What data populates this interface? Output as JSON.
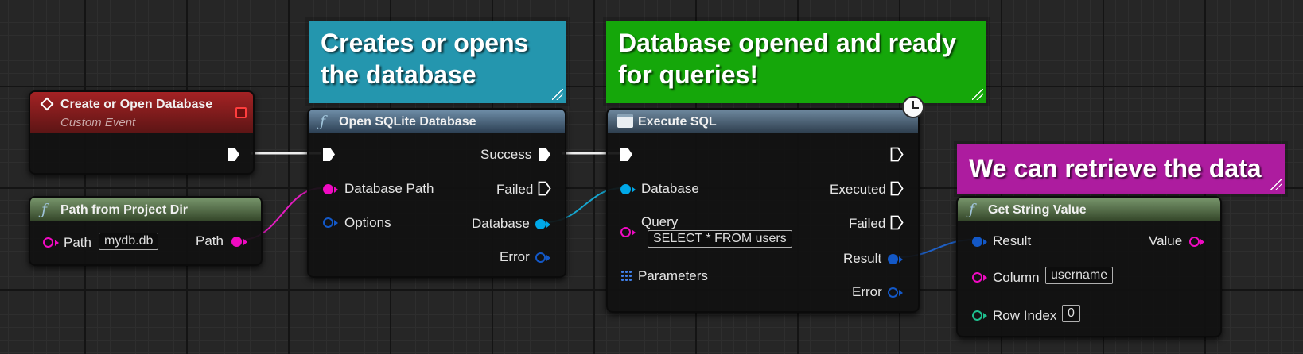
{
  "comments": {
    "create_or_open": "Creates or opens the database",
    "opened_ready": "Database opened and ready for queries!",
    "retrieve": "We can retrieve the data"
  },
  "nodes": {
    "event": {
      "title": "Create or Open Database",
      "subtitle": "Custom Event"
    },
    "path_from_project": {
      "title": "Path from Project Dir",
      "path_label": "Path",
      "path_value": "mydb.db",
      "output_label": "Path"
    },
    "open_sqlite": {
      "title": "Open SQLite Database",
      "inputs": {
        "database_path": "Database Path",
        "options": "Options"
      },
      "outputs": {
        "success": "Success",
        "failed": "Failed",
        "database": "Database",
        "error": "Error"
      }
    },
    "execute_sql": {
      "title": "Execute SQL",
      "inputs": {
        "database": "Database",
        "query": "Query",
        "query_value": "SELECT * FROM users",
        "parameters": "Parameters"
      },
      "outputs": {
        "executed": "Executed",
        "failed": "Failed",
        "result": "Result",
        "error": "Error"
      }
    },
    "get_string_value": {
      "title": "Get String Value",
      "inputs": {
        "result": "Result",
        "column": "Column",
        "column_value": "username",
        "row_index": "Row Index",
        "row_index_value": "0"
      },
      "outputs": {
        "value": "Value"
      }
    }
  },
  "colors": {
    "comment_blue": "#2496ae",
    "comment_green": "#15a70a",
    "comment_magenta": "#ad1c9f",
    "string_pin": "#f00ac2",
    "struct_pin_light": "#00a8e8",
    "struct_pin_dark": "#1358c7",
    "integer_pin": "#1ebf8e",
    "exec_pin": "#ffffff"
  },
  "icons": {
    "function": "function-f-icon",
    "event": "event-diamond-icon",
    "latent": "clock-icon",
    "macro": "window-icon",
    "array": "grid-icon"
  }
}
